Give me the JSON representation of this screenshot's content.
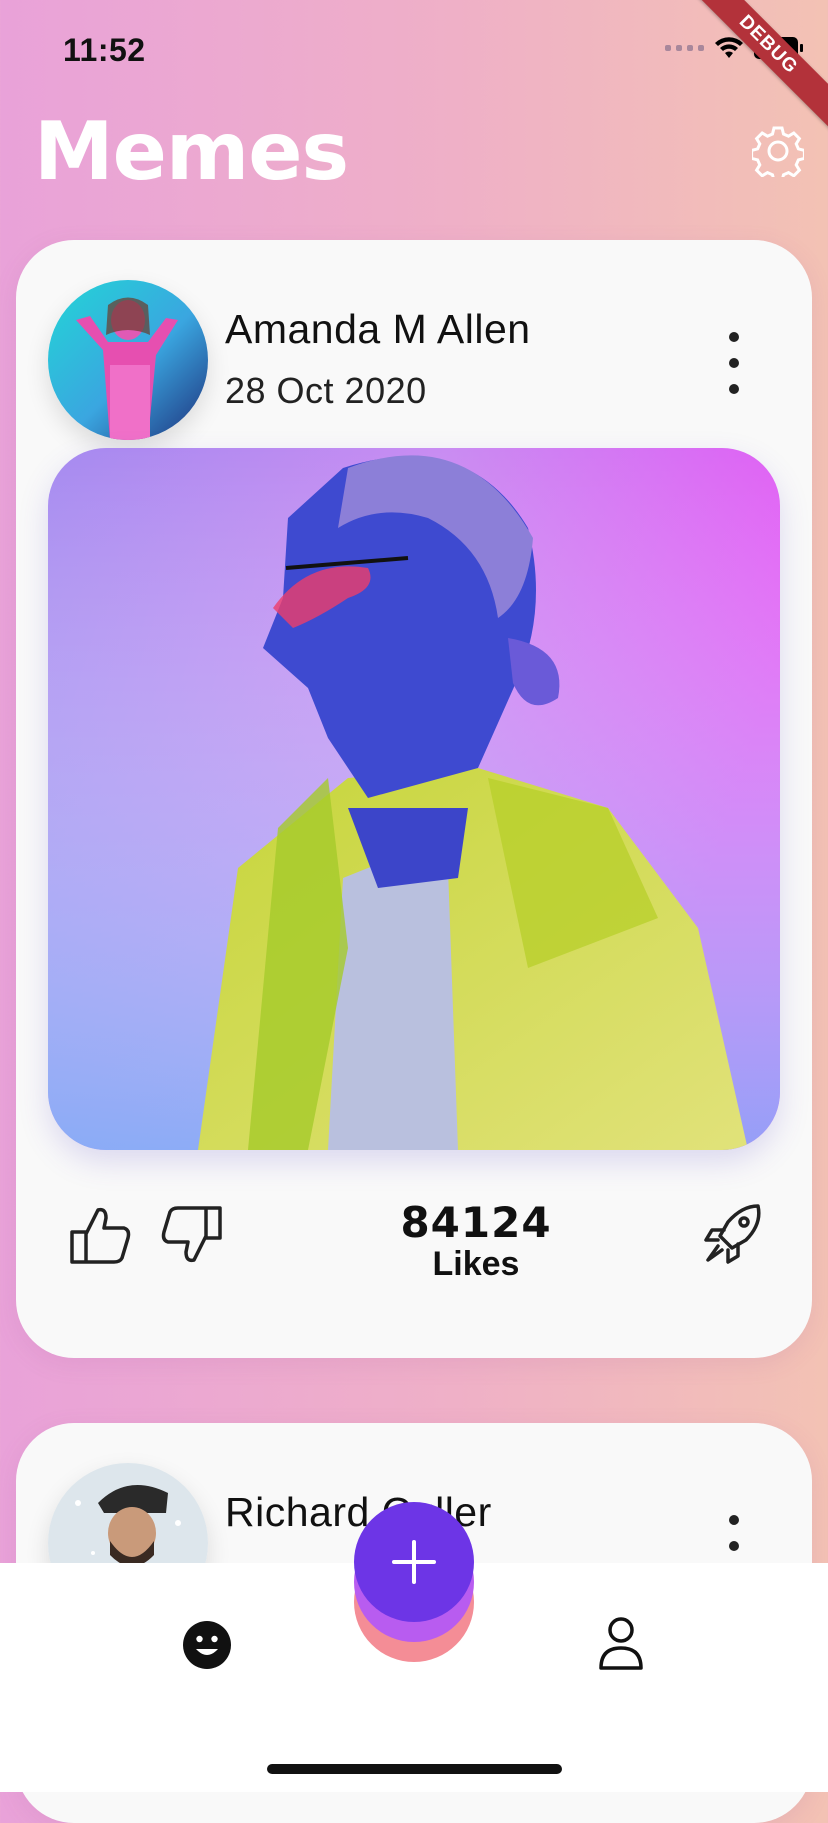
{
  "status_bar": {
    "time": "11:52"
  },
  "debug_banner": {
    "label": "DEBUG"
  },
  "header": {
    "title": "Memes",
    "settings_icon": "gear-icon"
  },
  "posts": [
    {
      "author": "Amanda M Allen",
      "date": "28 Oct 2020",
      "likes": "84124",
      "likes_label": "Likes"
    },
    {
      "author": "Richard Culler",
      "date": "",
      "likes": "",
      "likes_label": ""
    }
  ],
  "bottom_nav": {
    "left_icon": "smiley-face-icon",
    "fab_icon": "plus-icon",
    "right_icon": "person-icon"
  },
  "colors": {
    "fab": "#6d35e6",
    "fab_shadow_1": "#b85cf0",
    "fab_shadow_2": "#f48d96",
    "debug": "#b3323a"
  }
}
